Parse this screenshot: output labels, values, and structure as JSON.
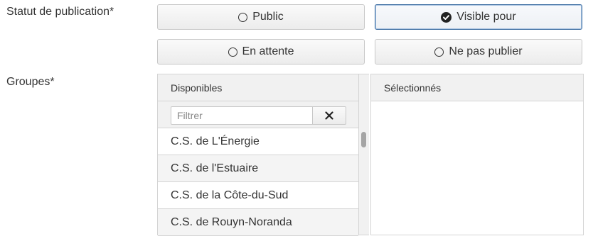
{
  "publication_status": {
    "label": "Statut de publication*",
    "options": [
      {
        "label": "Public",
        "selected": false
      },
      {
        "label": "Visible pour",
        "selected": true
      },
      {
        "label": "En attente",
        "selected": false
      },
      {
        "label": "Ne pas publier",
        "selected": false
      }
    ]
  },
  "groups": {
    "label": "Groupes*",
    "available": {
      "header": "Disponibles",
      "filter_placeholder": "Filtrer",
      "filter_value": "",
      "clear_icon": "close-icon",
      "items": [
        "C.S. de L'Énergie",
        "C.S. de l'Estuaire",
        "C.S. de la Côte-du-Sud",
        "C.S. de Rouyn-Noranda"
      ]
    },
    "selected": {
      "header": "Sélectionnés",
      "items": []
    }
  },
  "colors": {
    "selected_border": "#3c6da1",
    "row_alt": "#f4f4f4",
    "header_bg": "#f1f1f1"
  }
}
